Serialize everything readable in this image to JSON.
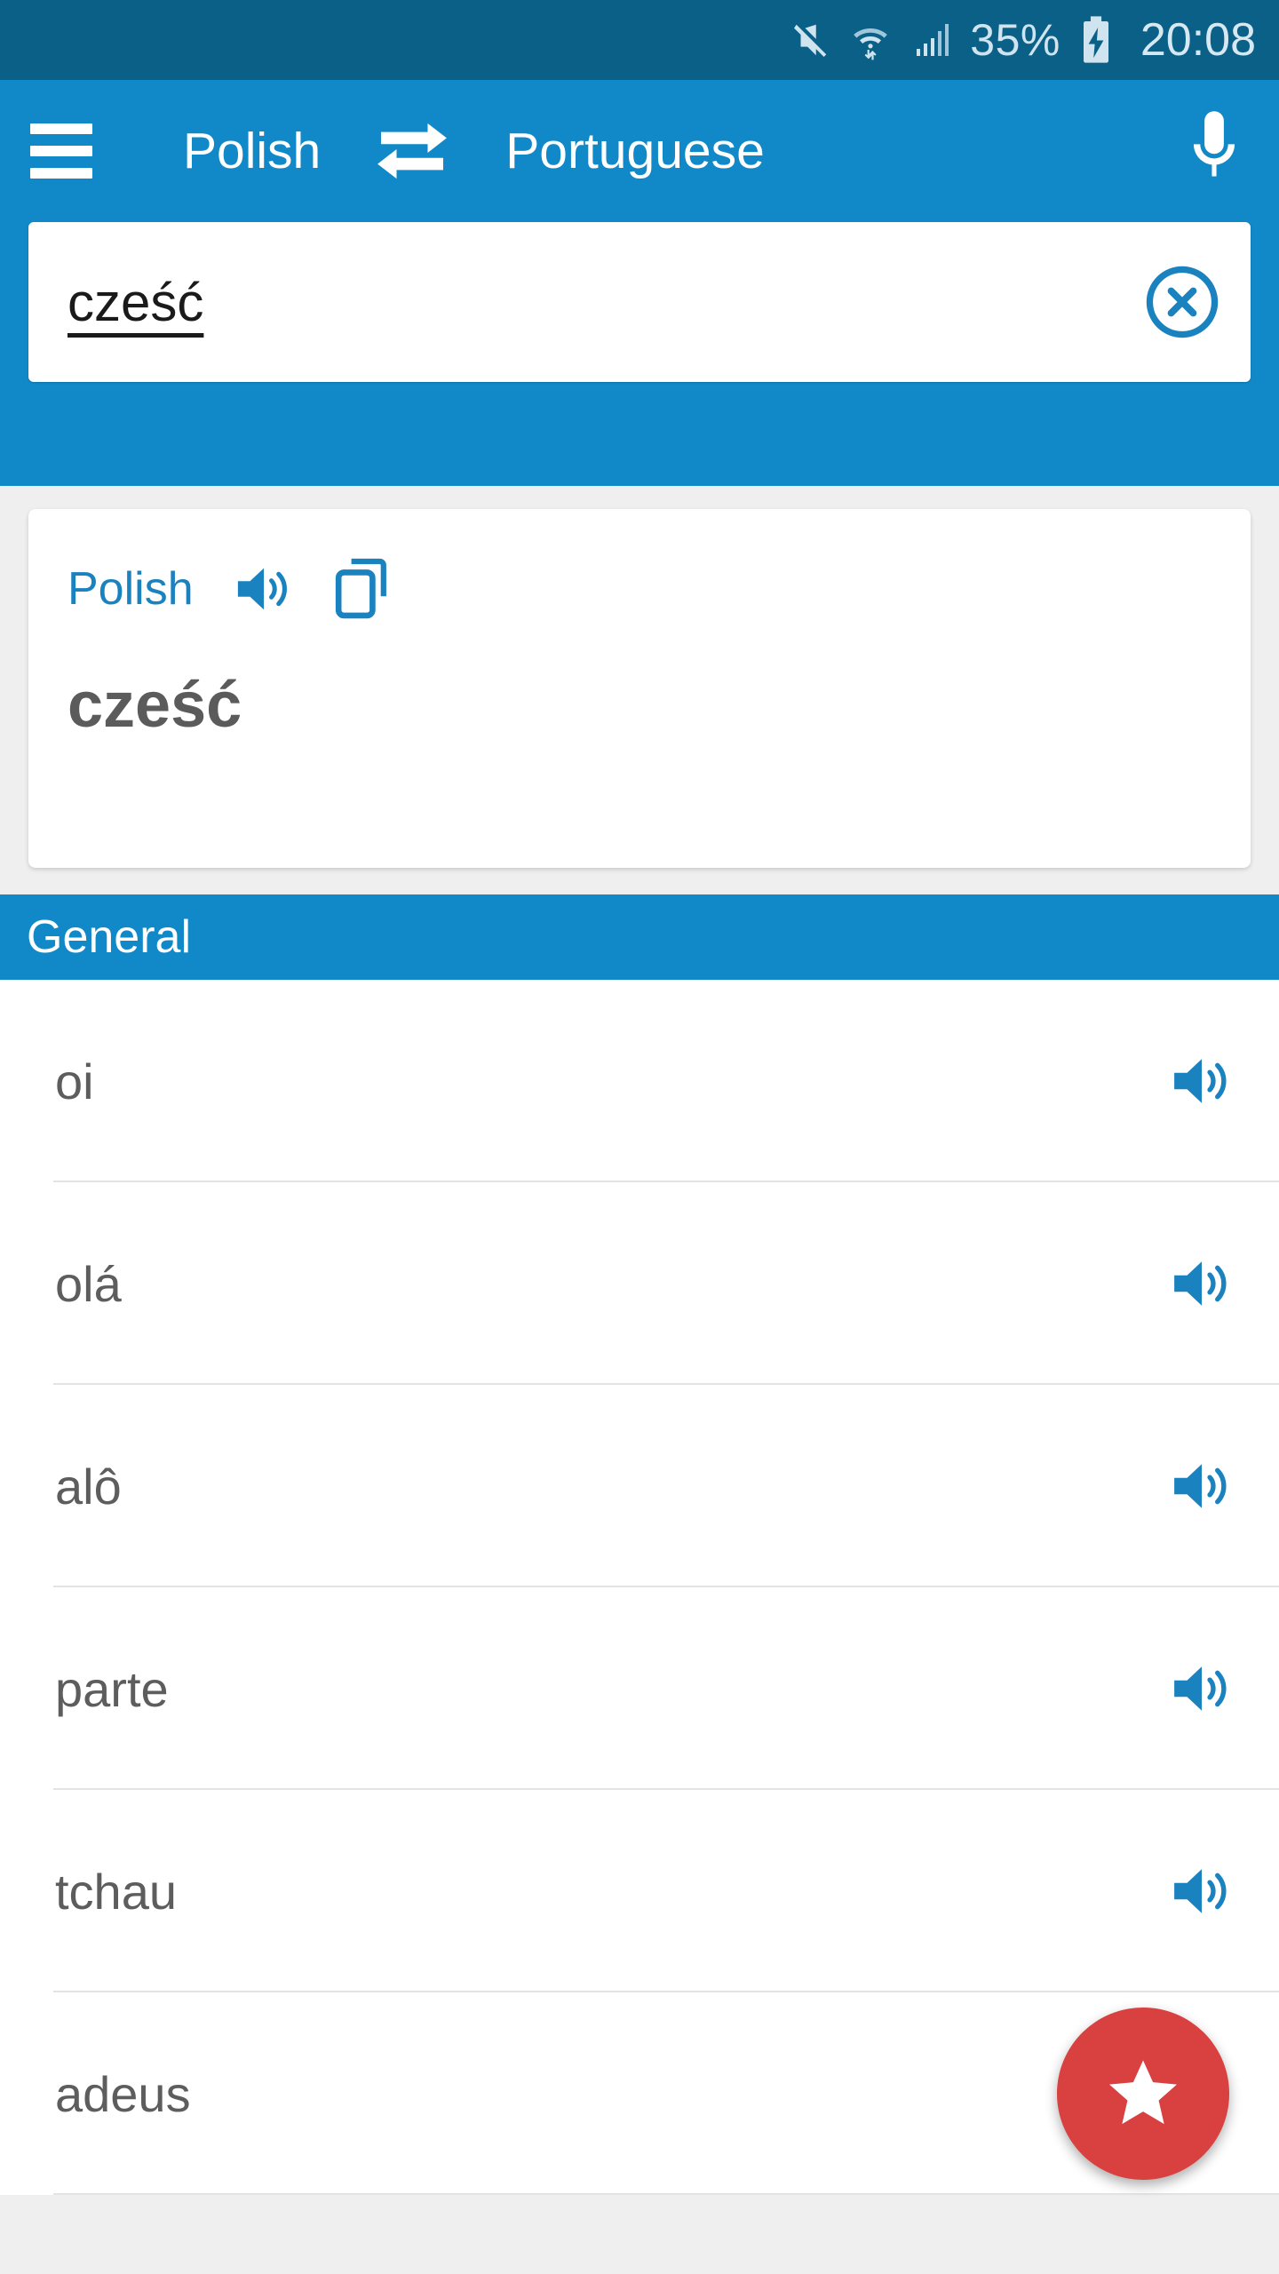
{
  "status_bar": {
    "icons": [
      "mute-icon",
      "wifi-icon",
      "signal-icon"
    ],
    "battery_percent": "35%",
    "battery_state": "charging",
    "clock": "20:08"
  },
  "app_bar": {
    "menu_icon": "hamburger-menu-icon",
    "source_language": "Polish",
    "swap_icon": "swap-languages-icon",
    "target_language": "Portuguese",
    "mic_icon": "microphone-icon"
  },
  "search": {
    "value": "cześć",
    "placeholder": "",
    "clear_icon": "clear-circle-x-icon"
  },
  "source_card": {
    "language_label": "Polish",
    "speaker_icon": "speaker-icon",
    "copy_icon": "copy-icon",
    "word": "cześć"
  },
  "section": {
    "title": "General"
  },
  "results": [
    {
      "word": "oi",
      "speaker_icon": "speaker-icon"
    },
    {
      "word": "olá",
      "speaker_icon": "speaker-icon"
    },
    {
      "word": "alô",
      "speaker_icon": "speaker-icon"
    },
    {
      "word": "parte",
      "speaker_icon": "speaker-icon"
    },
    {
      "word": "tchau",
      "speaker_icon": "speaker-icon"
    },
    {
      "word": "adeus",
      "speaker_icon": "speaker-icon"
    }
  ],
  "fab": {
    "icon": "star-icon",
    "color": "#d8413f"
  },
  "colors": {
    "status_bar": "#0b6088",
    "app_bar": "#1189c8",
    "accent_blue": "#1a82bf",
    "page_background": "#efefef",
    "list_background": "#ffffff",
    "word_text": "#5d5d5d",
    "fab_red": "#d8413f"
  }
}
